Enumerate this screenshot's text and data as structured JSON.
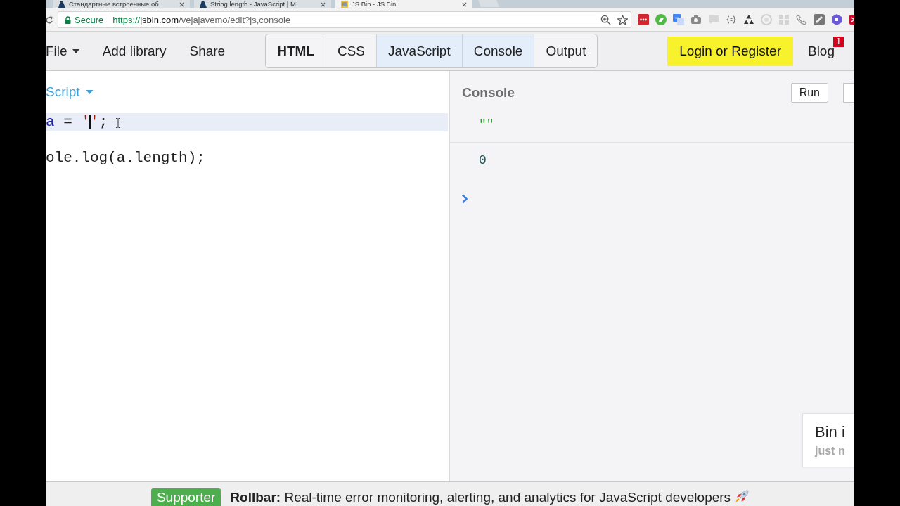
{
  "browser": {
    "tabs": [
      {
        "title": "Стандартные встроенные об",
        "kind": "docs",
        "selected": false
      },
      {
        "title": "String.length - JavaScript | M",
        "kind": "docs",
        "selected": false
      },
      {
        "title": "JS Bin - JS Bin",
        "kind": "bin",
        "selected": true
      }
    ],
    "address_bar": {
      "security_label": "Secure",
      "url": {
        "scheme": "https://",
        "host": "jsbin.com",
        "path": "/vejajavemo/edit?js,console"
      }
    }
  },
  "toolbar": {
    "menu_items": [
      {
        "label": "File",
        "dropdown": true
      },
      {
        "label": "Add library",
        "dropdown": false
      },
      {
        "label": "Share",
        "dropdown": false
      }
    ],
    "panel_tabs": [
      {
        "label": "HTML",
        "bold": true,
        "selected": false
      },
      {
        "label": "CSS",
        "bold": false,
        "selected": false
      },
      {
        "label": "JavaScript",
        "bold": false,
        "selected": true
      },
      {
        "label": "Console",
        "bold": false,
        "selected": true
      },
      {
        "label": "Output",
        "bold": false,
        "selected": false
      }
    ],
    "login_button": "Login or Register",
    "blog": {
      "label": "Blog",
      "badge": "1"
    }
  },
  "editor": {
    "language": "Script",
    "lines": [
      {
        "current": true,
        "tokens": [
          {
            "kind": "variable",
            "text": "a"
          },
          {
            "kind": "plain",
            "text": " = "
          },
          {
            "kind": "string",
            "text": "'"
          },
          {
            "kind": "caret"
          },
          {
            "kind": "string",
            "text": "'"
          },
          {
            "kind": "plain",
            "text": ";"
          }
        ]
      },
      {
        "current": false
      },
      {
        "current": false,
        "tokens": [
          {
            "kind": "plain",
            "text": "ole.log(a.length);"
          }
        ]
      }
    ]
  },
  "console": {
    "title": "Console",
    "run_button": "Run",
    "entries": [
      {
        "kind": "string",
        "text": "\"\""
      },
      {
        "kind": "number",
        "text": "0"
      }
    ]
  },
  "toast": {
    "title": "Bin i",
    "subtitle": "just n"
  },
  "footer": {
    "badge": "Supporter",
    "message": "**Rollbar:** Real-time error monitoring, alerting, and analytics for JavaScript developers"
  }
}
